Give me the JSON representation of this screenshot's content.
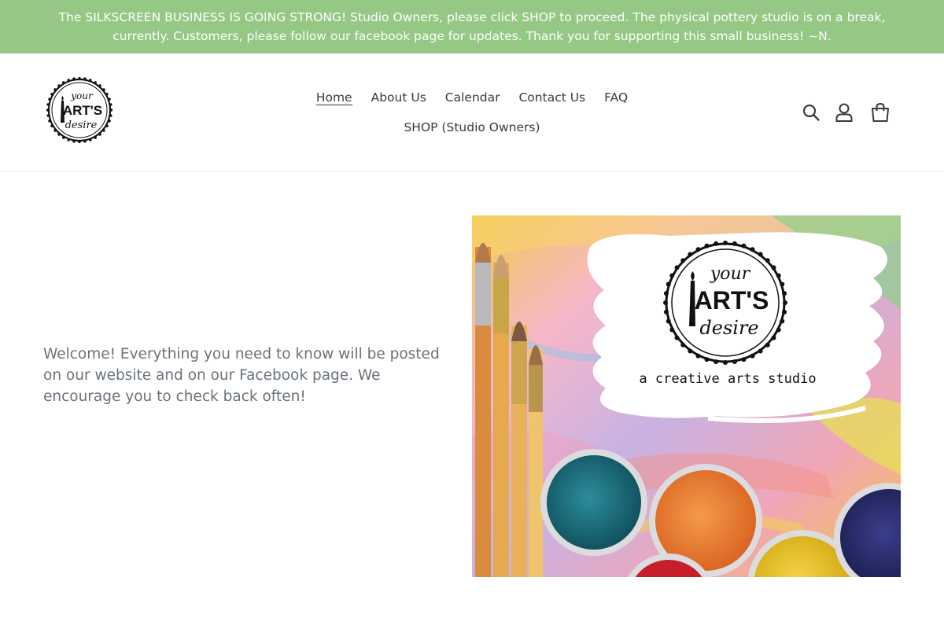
{
  "announcement": {
    "text": "The SILKSCREEN BUSINESS IS GOING STRONG! Studio Owners, please click SHOP to proceed. The physical pottery studio is on a break, currently. Customers, please follow our facebook page for updates. Thank you for supporting this small business! ~N.",
    "background": "#95c885"
  },
  "header": {
    "logo": {
      "line1": "your",
      "line2": "ART'S",
      "line3": "desire"
    },
    "nav": [
      {
        "label": "Home",
        "active": true
      },
      {
        "label": "About Us"
      },
      {
        "label": "Calendar"
      },
      {
        "label": "Contact Us"
      },
      {
        "label": "FAQ"
      },
      {
        "label": "SHOP (Studio Owners)"
      }
    ],
    "icons": [
      "search-icon",
      "account-icon",
      "cart-icon"
    ]
  },
  "main": {
    "welcome_text": "Welcome! Everything you need to know will be posted on our website and on our Facebook page. We encourage you to check back often!",
    "image": {
      "logo": {
        "line1": "your",
        "line2": "ART'S",
        "line3": "desire"
      },
      "tagline": "a creative arts studio",
      "paint_colors": [
        "#1d6f7e",
        "#e8782c",
        "#e9c21a",
        "#2a2c6b",
        "#c81e2c"
      ]
    }
  }
}
